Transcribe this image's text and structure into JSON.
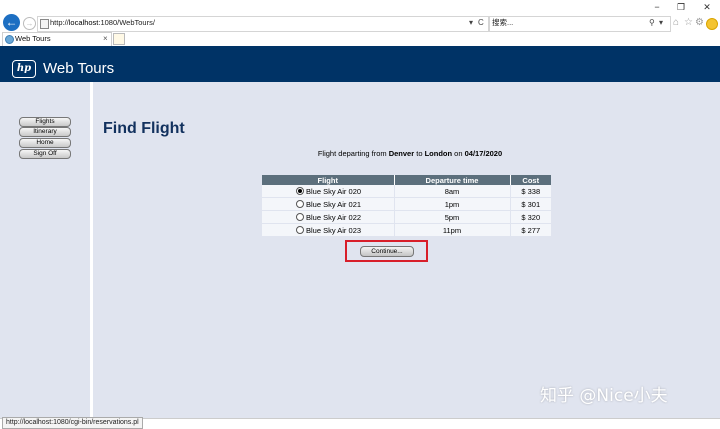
{
  "browser": {
    "url_prefix": "http://",
    "url_host": "localhost",
    "url_rest": ":1080/WebTours/",
    "url_dropdown": "▾",
    "refresh": "C",
    "search_placeholder": "搜索...",
    "search_icon": "⚲",
    "search_dropdown": "▾",
    "tab_title": "Web Tours",
    "tab_close": "×",
    "window_controls": [
      "−",
      "❐",
      "✕"
    ],
    "toolbar_icons": [
      "⌂",
      "☆",
      "⚙"
    ],
    "status_url": "http://localhost:1080/cgi-bin/reservations.pl"
  },
  "header": {
    "logo_text": "hp",
    "brand": "Web Tours"
  },
  "nav": {
    "items": [
      "Flights",
      "Itinerary",
      "Home",
      "Sign Off"
    ]
  },
  "page": {
    "title": "Find Flight",
    "desc_prefix": "Flight departing from ",
    "from": "Denver",
    "to_word": " to ",
    "to": "London",
    "on_word": " on ",
    "date": "04/17/2020"
  },
  "table": {
    "headers": [
      "Flight",
      "Departure time",
      "Cost"
    ],
    "rows": [
      {
        "flight": "Blue Sky Air 020",
        "time": "8am",
        "cost": "$ 338",
        "selected": true
      },
      {
        "flight": "Blue Sky Air 021",
        "time": "1pm",
        "cost": "$ 301",
        "selected": false
      },
      {
        "flight": "Blue Sky Air 022",
        "time": "5pm",
        "cost": "$ 320",
        "selected": false
      },
      {
        "flight": "Blue Sky Air 023",
        "time": "11pm",
        "cost": "$ 277",
        "selected": false
      }
    ]
  },
  "continue_label": "Continue...",
  "watermark": "知乎 @Nice小夫",
  "colors": {
    "header_bg": "#003366",
    "page_bg": "#e0e4ef",
    "table_header_bg": "#5c6f7c",
    "highlight": "#d81e2a",
    "title": "#12315e"
  }
}
